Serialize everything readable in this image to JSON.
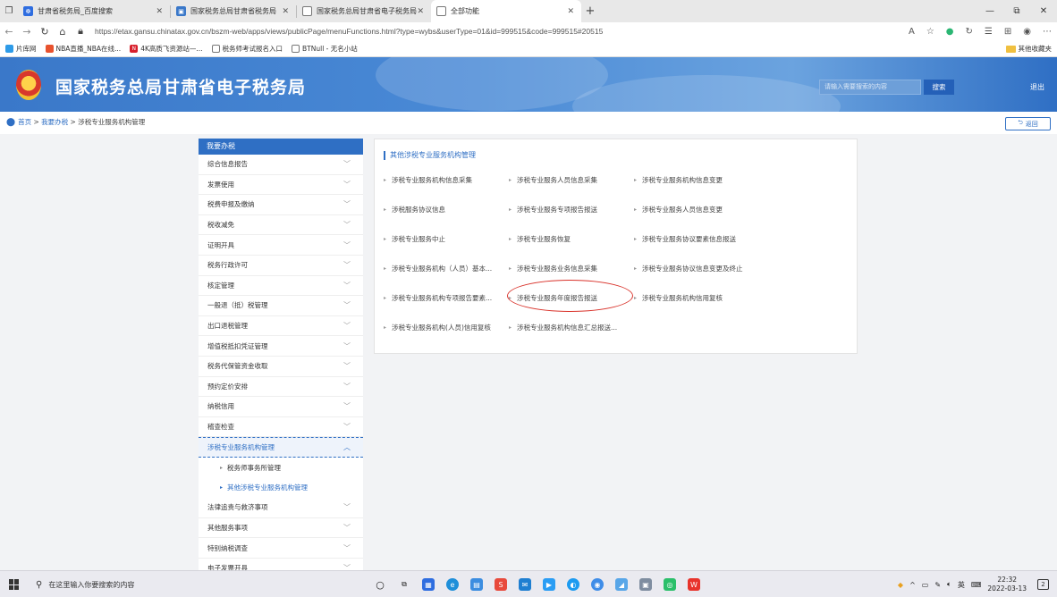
{
  "browser": {
    "tabs": [
      {
        "label": "甘肃省税务局_百度搜索",
        "icon_color": "#2e6de0",
        "active": false
      },
      {
        "label": "国家税务总局甘肃省税务局",
        "icon_color": "#3a78c9",
        "active": false
      },
      {
        "label": "国家税务总局甘肃省电子税务局",
        "icon_color": "#777777",
        "active": false
      },
      {
        "label": "全部功能",
        "icon_color": "#777777",
        "active": true
      }
    ],
    "url": "https://etax.gansu.chinatax.gov.cn/bszm-web/apps/views/publicPage/menuFunctions.html?type=wybs&userType=01&id=999515&code=999515#20515",
    "bookmarks": [
      {
        "label": "片库网",
        "color": "#2e9be8"
      },
      {
        "label": "NBA直播_NBA在线...",
        "color": "#e8522e"
      },
      {
        "label": "4K高质飞资源站—...",
        "color": "#d8202c"
      },
      {
        "label": "税务师考试报名入口",
        "color": "#777777"
      },
      {
        "label": "BTNull - 无名小站",
        "color": "#777777"
      }
    ],
    "other_bookmarks": "其他收藏夹"
  },
  "header": {
    "title": "国家税务总局甘肃省电子税务局",
    "search_placeholder": "请输入需要搜索的内容",
    "search_button": "搜索",
    "logout": "退出"
  },
  "breadcrumb": {
    "home": "首页",
    "sep1": " > ",
    "level1": "我要办税",
    "sep2": " > ",
    "current": "涉税专业服务机构管理"
  },
  "back_button": "返回",
  "sidebar": {
    "heading": "我要办税",
    "items_before": [
      "综合信息报告",
      "发票使用",
      "税费申报及缴纳",
      "税收减免",
      "证明开具",
      "税务行政许可",
      "核定管理",
      "一般退（抵）税管理",
      "出口退税管理",
      "增值税抵扣凭证管理",
      "税务代保管资金收取",
      "预约定价安排",
      "纳税信用",
      "稽查检查"
    ],
    "active_item": "涉税专业服务机构管理",
    "sub_items": [
      "税务师事务所管理",
      "其他涉税专业服务机构管理"
    ],
    "items_after": [
      "法律追责与救济事项",
      "其他服务事项",
      "特别纳税调查",
      "电子发票开具"
    ]
  },
  "panel": {
    "title": "其他涉税专业服务机构管理",
    "functions": [
      [
        "涉税专业服务机构信息采集",
        "涉税专业服务人员信息采集",
        "涉税专业服务机构信息变更"
      ],
      [
        "涉税服务协议信息",
        "涉税专业服务专项报告报送",
        "涉税专业服务人员信息变更"
      ],
      [
        "涉税专业服务中止",
        "涉税专业服务恢复",
        "涉税专业服务协议要素信息报送"
      ],
      [
        "涉税专业服务机构（人员）基本...",
        "涉税专业服务业务信息采集",
        "涉税专业服务协议信息变更及终止"
      ],
      [
        "涉税专业服务机构专项报告要素...",
        "涉税专业服务年度报告报送",
        "涉税专业服务机构信用复核"
      ],
      [
        "涉税专业服务机构(人员)信用复核",
        "涉税专业服务机构信息汇总报送..."
      ]
    ]
  },
  "taskbar": {
    "search_placeholder": "在这里输入你要搜索的内容",
    "ime": "英",
    "time": "22:32",
    "date": "2022-03-13",
    "notifications": "2"
  }
}
